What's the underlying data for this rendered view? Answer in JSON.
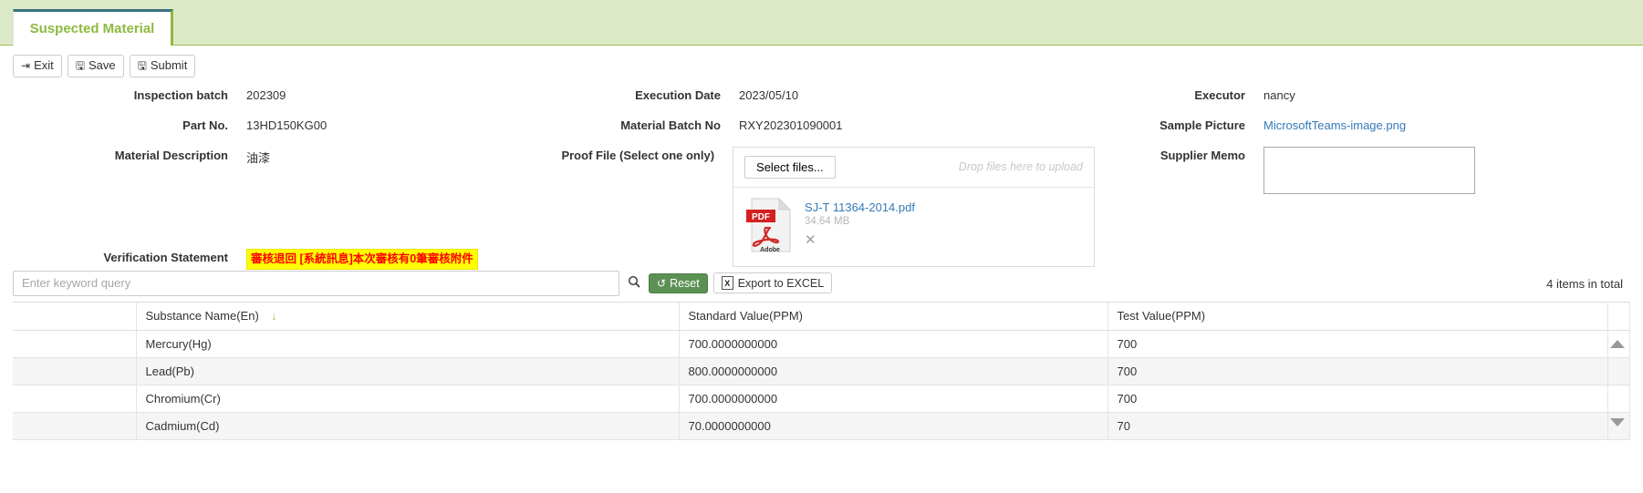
{
  "tab": {
    "label": "Suspected Material"
  },
  "toolbar": {
    "exit": {
      "label": "Exit",
      "icon": "exit-icon",
      "glyph": "⇥"
    },
    "save": {
      "label": "Save",
      "icon": "save-icon",
      "glyph": "🖫"
    },
    "submit": {
      "label": "Submit",
      "icon": "submit-icon",
      "glyph": "🖫"
    }
  },
  "form": {
    "column1": [
      {
        "label": "Inspection batch",
        "value": "202309"
      },
      {
        "label": "Part No.",
        "value": "13HD150KG00"
      },
      {
        "label": "Material Description",
        "value": "油漆"
      }
    ],
    "column2": [
      {
        "label": "Execution Date",
        "value": "2023/05/10"
      },
      {
        "label": "Material Batch No",
        "value": "RXY202301090001"
      }
    ],
    "proof_file": {
      "label": "Proof File (Select one only)",
      "select_button": "Select files...",
      "drop_hint": "Drop files here to upload",
      "file": {
        "name": "SJ-T 11364-2014.pdf",
        "size": "34.64 MB",
        "type_badge": "PDF",
        "brand": "Adobe",
        "remove_icon": "close-icon",
        "remove_glyph": "✕"
      }
    },
    "column3": [
      {
        "label": "Executor",
        "value": "nancy"
      }
    ],
    "sample_picture": {
      "label": "Sample Picture",
      "value": "MicrosoftTeams-image.png"
    },
    "supplier_memo": {
      "label": "Supplier Memo",
      "value": "",
      "placeholder": ""
    },
    "verification_statement": {
      "label": "Verification Statement",
      "message": "審核退回 [系統訊息]本次審核有0筆審核附件"
    }
  },
  "search": {
    "placeholder": "Enter keyword query",
    "value": "",
    "search_icon": "search-icon",
    "search_glyph": "🔍",
    "reset_label": "Reset",
    "reset_icon": "reset-icon",
    "reset_glyph": "↺",
    "export_label": "Export to EXCEL",
    "export_icon": "excel-icon",
    "export_glyph": "X",
    "items_total": "4 items in total"
  },
  "table": {
    "headers": {
      "select": "",
      "substance": "Substance Name(En)",
      "sort_glyph": "↓",
      "standard": "Standard Value(PPM)",
      "test": "Test Value(PPM)"
    },
    "rows": [
      {
        "substance": "Mercury(Hg)",
        "standard": "700.0000000000",
        "test": "700"
      },
      {
        "substance": "Lead(Pb)",
        "standard": "800.0000000000",
        "test": "700"
      },
      {
        "substance": "Chromium(Cr)",
        "standard": "700.0000000000",
        "test": "700"
      },
      {
        "substance": "Cadmium(Cd)",
        "standard": "70.0000000000",
        "test": "70"
      }
    ]
  },
  "colors": {
    "tab_text": "#8cba3f",
    "tab_top_border": "#3b7282",
    "header_bg": "#dce9c6",
    "link": "#337ab7",
    "reset_green": "#5b9153",
    "highlight_bg": "#ffff00",
    "highlight_text": "#ff0000",
    "sort_arrow": "#7ab648"
  }
}
